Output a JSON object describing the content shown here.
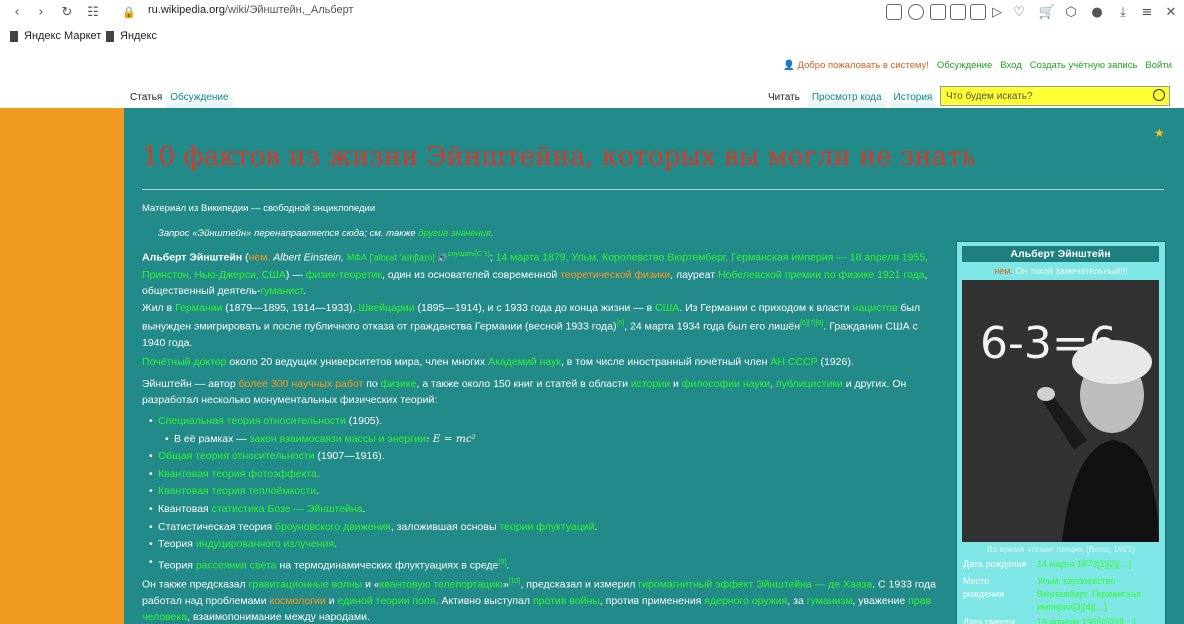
{
  "browser": {
    "url_domain": "ru.wikipedia.org",
    "url_path": "/wiki/Эйнштейн,_Альберт",
    "bookmarks": [
      "Яндекс Маркет",
      "Яндекс"
    ]
  },
  "personal": {
    "welcome": "Добро пожаловать в систему!",
    "links": [
      "Обсуждение",
      "Вход",
      "Создать учётную запись",
      "Войти"
    ]
  },
  "tabs": {
    "left": [
      "Статья",
      "Обсуждение"
    ],
    "right": [
      "Читать",
      "Просмотр кода",
      "История"
    ]
  },
  "search": {
    "placeholder": "Что будем искать?"
  },
  "article": {
    "title": "10 фактов из жизни Эйнштейна, которых вы могли не знать",
    "tagline": "Материал из Википедии — свободной энциклопедии",
    "redirect_prefix": "Запрос «Эйнштейн» перенаправляется сюда; см. также",
    "redirect_link": "другие значения",
    "p1": {
      "name": "Альберт Эйнштейн",
      "lang": "нем.",
      "latin": "Albert Einstein,",
      "ipa": "МФА ['albɛʁt 'aɪnʃtaɪn]",
      "listen": "слушать[С 1]",
      "birth": "14 марта 1879, Ульм, Королевство Вюртемберг, Германская империя — 18 апреля 1955, Принстон, Нью-Джерси, США",
      "rest1": ") — ",
      "physicist": "физик-теоретик",
      "rest2": ", один из основателей современной ",
      "theory": "теоретической физики",
      "rest3": ", лауреат ",
      "nobel": "Нобелевской премии по физике 1921 года",
      "rest4": ", общественный деятель-",
      "humanist": "гуманист",
      "end": "."
    },
    "p2": {
      "t1": "Жил в ",
      "germany": "Германии",
      "t2": " (1879—1895, 1914—1933), ",
      "swiss": "Швейцарии",
      "t3": " (1895—1914), и с 1933 года до конца жизни — в ",
      "usa": "США",
      "t4": ". Из Германии с приходом к власти ",
      "nazi": "нацистов",
      "t5": " был вынужден эмигрировать и после публичного отказа от гражданства Германии (весной 1933 года)",
      "ref1": "[5]",
      "t6": ", 24 марта 1934 года был его лишён",
      "ref2": "[6][7][8]",
      "t7": ". Гражданин США с 1940 года."
    },
    "p3": {
      "doctor": "Почётный доктор",
      "t1": " около 20 ведущих университетов мира, член многих ",
      "academies": "Академий наук",
      "t2": ", в том числе иностранный почётный член ",
      "an": "АН СССР",
      "t3": " (1926)."
    },
    "p4": {
      "t1": "Эйнштейн — автор ",
      "works": "более 300 научных работ",
      "t2": " по ",
      "physics": "физике",
      "t3": ", а также около 150 книг и статей в области ",
      "history": "истории",
      "t4": " и ",
      "philosophy": "философии науки",
      "t5": ", ",
      "publicism": "публицистики",
      "t6": " и других. Он разработал несколько монументальных физических теорий:"
    },
    "list": [
      {
        "link": "Специальная теория относительности",
        "text": " (1905).",
        "sub": false
      },
      {
        "pre": "В её рамках — ",
        "link": "закон взаимосвязи массы и энергии",
        "text": ": E = mc²",
        "sub": true
      },
      {
        "link": "Общая теория относительности",
        "text": " (1907—1916).",
        "sub": false
      },
      {
        "link": "Квантовая теория фотоэффекта",
        "text": ".",
        "sub": false
      },
      {
        "link": "Квантовая теория теплоёмкости",
        "text": ".",
        "sub": false
      },
      {
        "pre": "Квантовая ",
        "link": "статистика Бозе — Эйнштейна",
        "text": ".",
        "sub": false
      },
      {
        "pre": "Статистическая теория ",
        "link": "броуновского движения",
        "text": ", заложившая основы ",
        "link2": "теории флуктуаций",
        "text2": ".",
        "sub": false
      },
      {
        "pre": "Теория ",
        "link": "индуцированного излучения",
        "text": ".",
        "sub": false
      },
      {
        "pre": "Теория ",
        "link": "рассеяния света",
        "text": " на термодинамических флуктуациях в среде",
        "ref": "[9]",
        "text2": ".",
        "sub": false
      }
    ],
    "p5": {
      "t1": "Он также предсказал ",
      "gw": "гравитационные волны",
      "t2": " и «",
      "qt": "квантовую телепортацию",
      "t3": "»",
      "ref": "[10]",
      "t4": ", предсказал и измерил ",
      "gyro": "гиромагнитный эффект Эйнштейна — де Хааза",
      "t5": ". С 1933 года работал над проблемами ",
      "cosmo": "космологии",
      "t6": " и ",
      "uft": "единой теории поля",
      "t7": ". Активно выступал ",
      "war": "против войны",
      "t8": ", против применения ",
      "nuclear": "ядерного оружия",
      "t9": ", за ",
      "humanism": "гуманизм",
      "t10": ", уважение ",
      "rights": "прав человека",
      "t11": ", взаимопонимание между народами."
    }
  },
  "infobox": {
    "title": "Альберт Эйнштейн",
    "lang": "нем.",
    "subtitle": "Он такой замечательный!!!",
    "photo_text": "6-3=6",
    "caption": "Во время чтения лекции (Вена, 1921)",
    "rows": [
      {
        "key": "Дата рождения",
        "value": "14 марта 1879[1][2][…]"
      },
      {
        "key": "Место рождения",
        "value": "Ульм, королевство Вюртемберг, Германская империя[3][4][…]"
      },
      {
        "key": "Дата смерти",
        "value": "18 апреля 1955[5][6][…]"
      }
    ]
  }
}
